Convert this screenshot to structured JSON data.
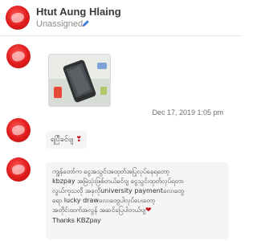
{
  "header": {
    "contact_name": "Htut Aung Hlaing",
    "assignee_status": "Unassigned",
    "edit_icon": "pencil-icon"
  },
  "messages": [
    {
      "type": "image",
      "image_description": "photo",
      "timestamp": "Dec 17, 2019 1:05 pm"
    },
    {
      "type": "text",
      "text": "ရပြီခင်ဗျ",
      "emoji": "❣"
    },
    {
      "type": "text",
      "lines": [
        "ကျွန်တော်က ငွေအသွင်းအထုတ်အပြုလုပ်နေရတော့",
        "kbzpay အမြဲသုံးဖြစ်တယ်ခင်ဗျ ငွေသွင်းထုတ်လုပ်ရတာ",
        "လွယ်ကူသလို အခုလိုuniversity paymentလေးတွေ",
        "ရော lucky drawလေးတွေပါလုပ်ပေးတော့",
        "အတိုင်းထက်အလွန် အဆင်ပြေပါတယ်ဗျ"
      ],
      "emoji": "❤",
      "signature": "Thanks KBZpay"
    }
  ],
  "colors": {
    "avatar_red": "#e01b1b",
    "bubble_bg": "#f4f5f7",
    "heart": "#c1121f",
    "pencil": "#3b7ddd"
  }
}
